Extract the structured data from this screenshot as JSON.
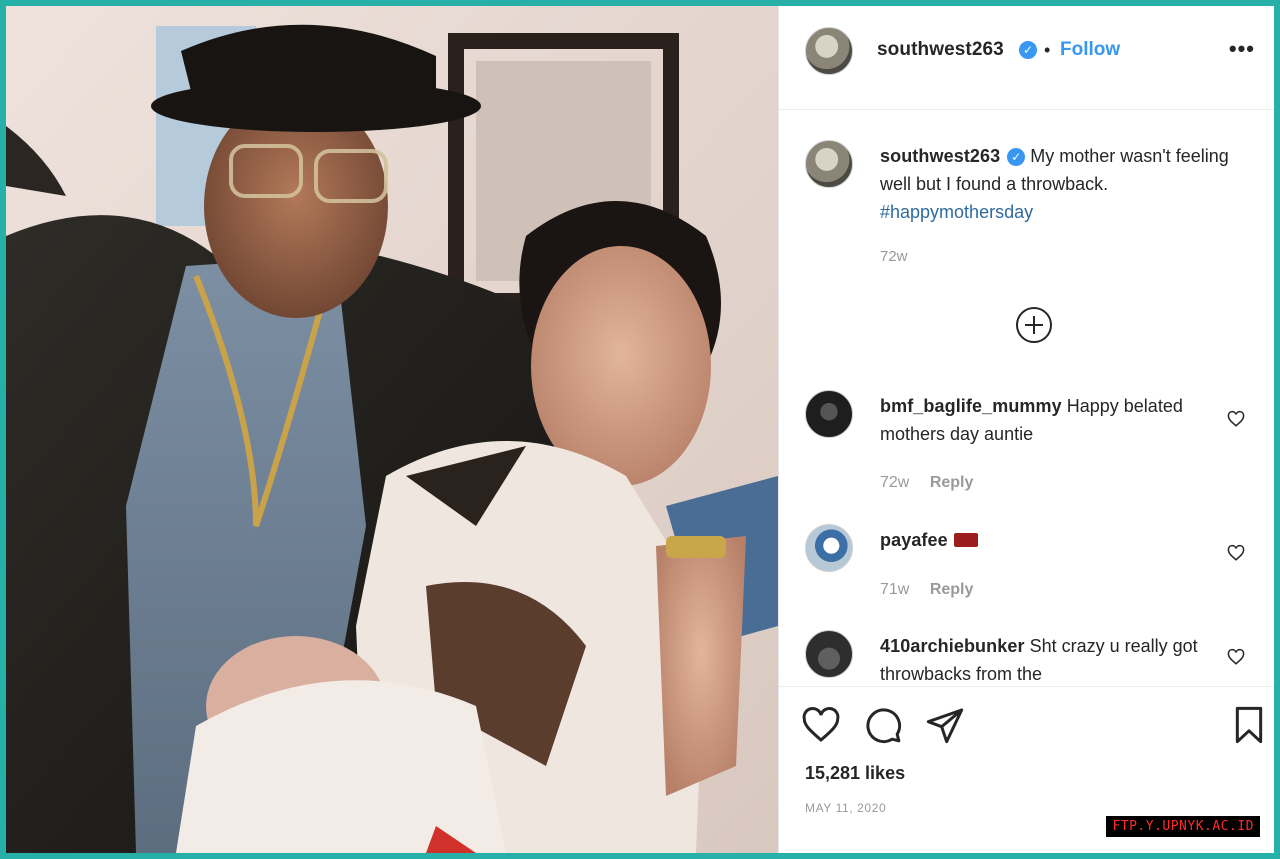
{
  "post": {
    "author": "southwest263",
    "follow_label": "Follow",
    "separator": "•",
    "more_label": "•••",
    "caption": {
      "username": "southwest263",
      "text": " My mother wasn't feeling well but I found a throwback.",
      "hashtag": "#happymothersday",
      "time": "72w"
    },
    "comments": [
      {
        "username": "bmf_baglife_mummy",
        "text": " Happy belated mothers day auntie",
        "time": "72w",
        "reply": "Reply"
      },
      {
        "username": "payafee",
        "text": "",
        "time": "71w",
        "reply": "Reply"
      },
      {
        "username": "410archiebunker",
        "text": " Sht crazy u really got throwbacks from the"
      }
    ],
    "likes": "15,281 likes",
    "date": "MAY 11, 2020"
  },
  "icons": [
    "verified-badge-icon",
    "more-options-icon",
    "load-more-comments-icon",
    "heart-icon",
    "comment-icon",
    "share-icon",
    "bookmark-icon"
  ],
  "colors": {
    "follow": "#3897f0",
    "hashtag": "#2f6b9e",
    "border": "#27b0a8",
    "watermark_text": "#ff2a2a"
  },
  "watermark": "FTP.Y.UPNYK.AC.ID"
}
